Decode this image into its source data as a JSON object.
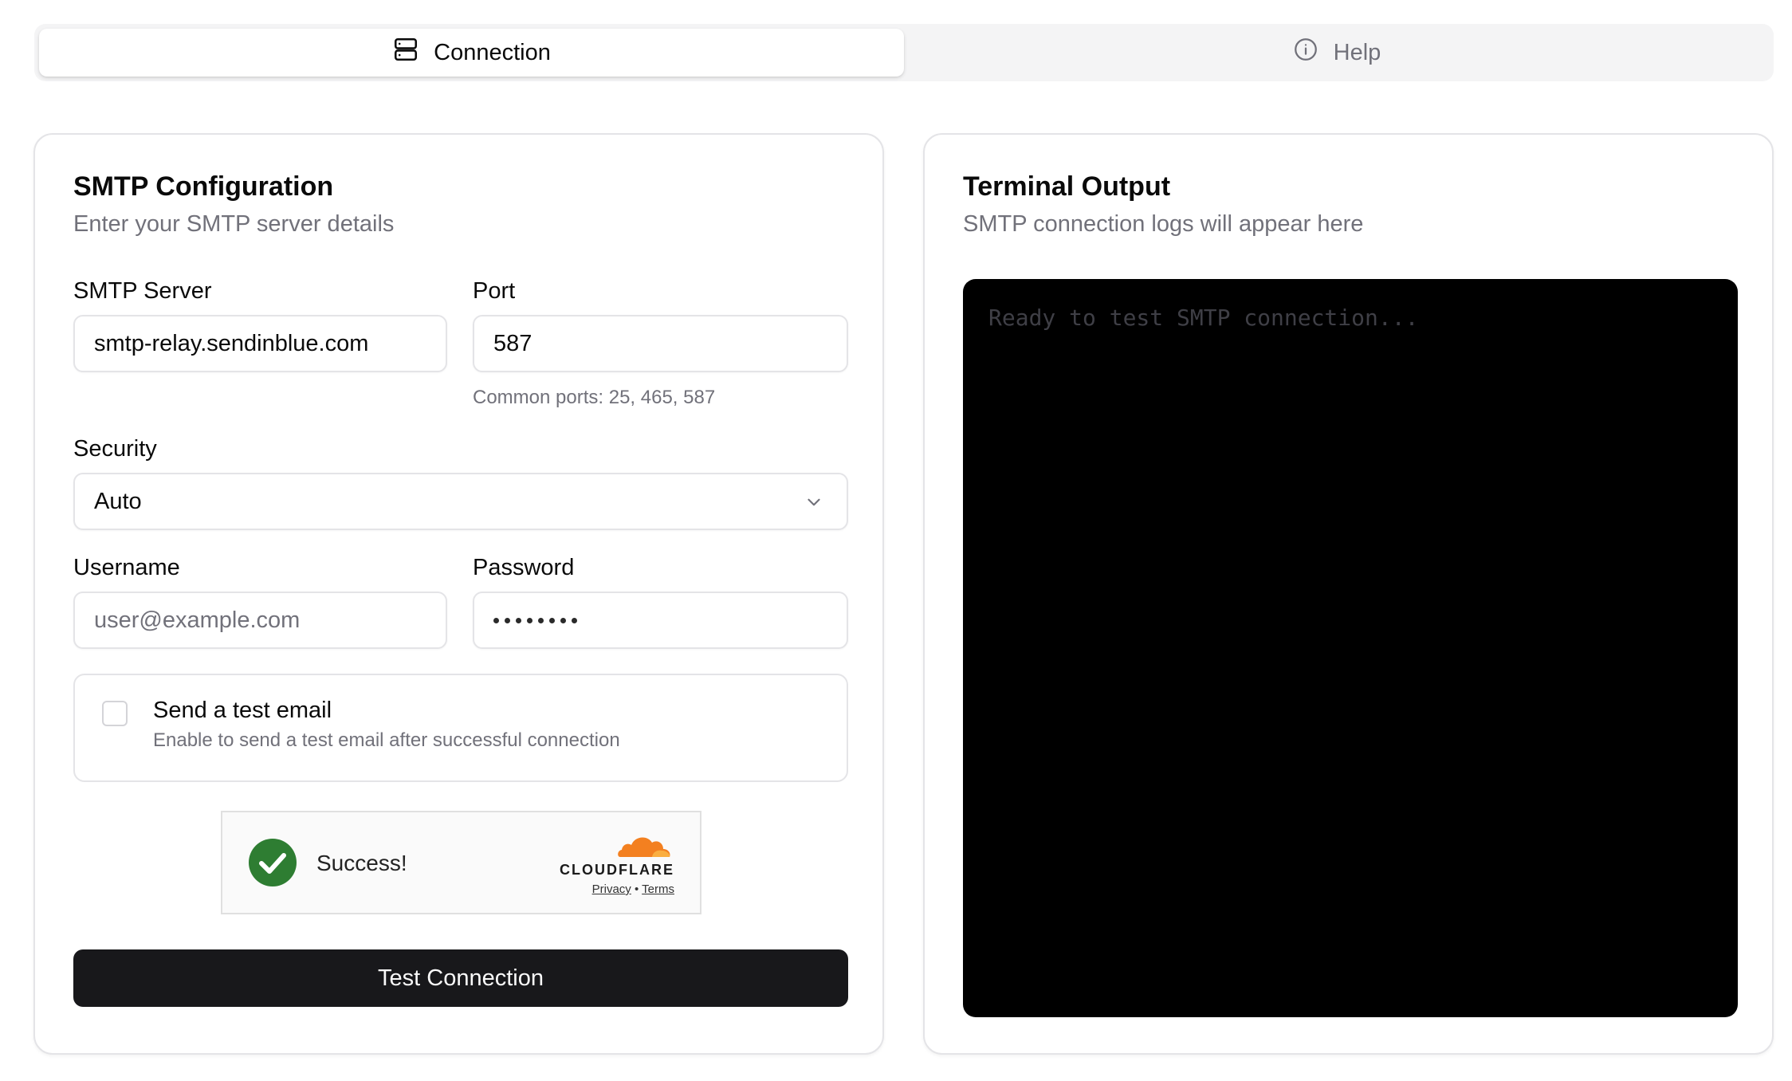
{
  "tabs": [
    {
      "label": "Connection",
      "icon": "server-icon",
      "active": true
    },
    {
      "label": "Help",
      "icon": "info-icon",
      "active": false
    }
  ],
  "config": {
    "title": "SMTP Configuration",
    "description": "Enter your SMTP server details",
    "server": {
      "label": "SMTP Server",
      "value": "smtp-relay.sendinblue.com"
    },
    "port": {
      "label": "Port",
      "value": "587",
      "hint": "Common ports: 25, 465, 587"
    },
    "security": {
      "label": "Security",
      "value": "Auto"
    },
    "username": {
      "label": "Username",
      "placeholder": "user@example.com"
    },
    "password": {
      "label": "Password",
      "masked_length": 8
    },
    "test_email": {
      "title": "Send a test email",
      "description": "Enable to send a test email after successful connection",
      "checked": false
    },
    "captcha": {
      "status": "Success!",
      "brand": "CLOUDFLARE",
      "privacy": "Privacy",
      "separator": "•",
      "terms": "Terms"
    },
    "submit_label": "Test Connection"
  },
  "terminal": {
    "title": "Terminal Output",
    "description": "SMTP connection logs will appear here",
    "placeholder": "Ready to test SMTP connection..."
  },
  "colors": {
    "primary": "#18181b",
    "muted": "#71717a",
    "border": "#e4e4e7",
    "success": "#2e7d32",
    "cloudflare_orange": "#f38020"
  }
}
